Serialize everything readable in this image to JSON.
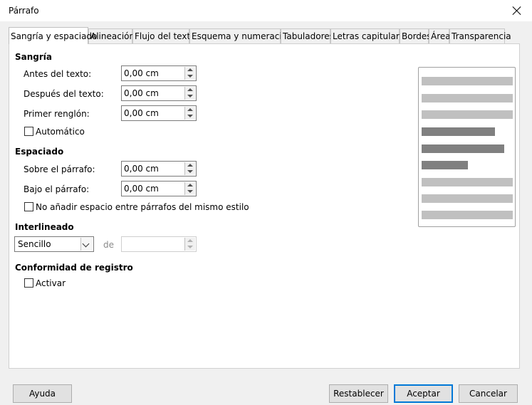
{
  "window": {
    "title": "Párrafo"
  },
  "tabs": [
    {
      "label": "Sangría y espaciado"
    },
    {
      "label": "Alineación"
    },
    {
      "label": "Flujo del texto"
    },
    {
      "label": "Esquema y numeración"
    },
    {
      "label": "Tabuladores"
    },
    {
      "label": "Letras capitulares"
    },
    {
      "label": "Bordes"
    },
    {
      "label": "Área"
    },
    {
      "label": "Transparencia"
    }
  ],
  "sangria": {
    "heading": "Sangría",
    "before_label": "Antes del texto:",
    "before_value": "0,00 cm",
    "after_label": "Después del texto:",
    "after_value": "0,00 cm",
    "first_label": "Primer renglón:",
    "first_value": "0,00 cm",
    "auto_label": "Automático"
  },
  "espaciado": {
    "heading": "Espaciado",
    "above_label": "Sobre el párrafo:",
    "above_value": "0,00 cm",
    "below_label": "Bajo el párrafo:",
    "below_value": "0,00 cm",
    "no_space_label": "No añadir espacio entre párrafos del mismo estilo"
  },
  "interlineado": {
    "heading": "Interlineado",
    "selected": "Sencillo",
    "de_label": "de"
  },
  "conformidad": {
    "heading": "Conformidad de registro",
    "activate_label": "Activar"
  },
  "colors": {
    "preview_light": "#c0c0c0",
    "preview_dark": "#808080",
    "accent": "#0078d7"
  },
  "buttons": {
    "help": "Ayuda",
    "reset": "Restablecer",
    "ok": "Aceptar",
    "cancel": "Cancelar"
  }
}
